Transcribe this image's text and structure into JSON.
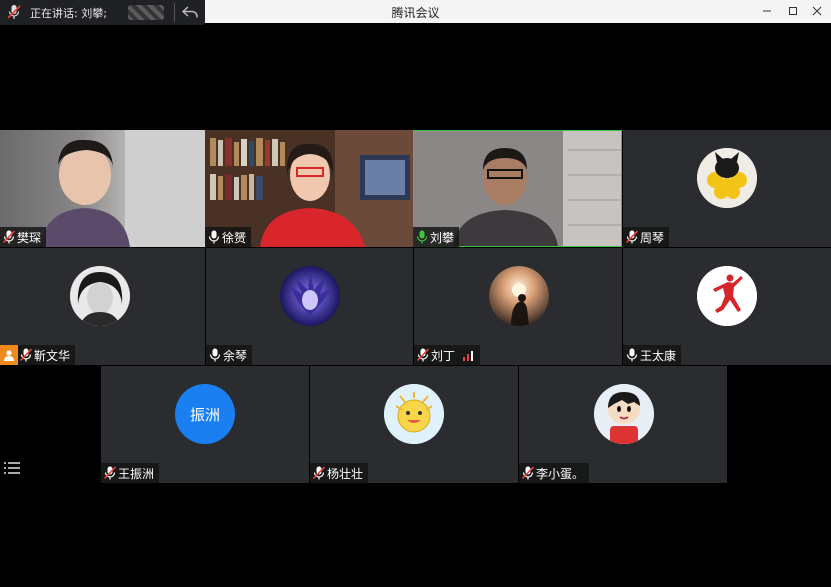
{
  "window": {
    "title": "腾讯会议",
    "speaking_label": "正在讲话: 刘攀;"
  },
  "participants": [
    {
      "name": "樊琛",
      "type": "video",
      "mic": "muted"
    },
    {
      "name": "徐赟",
      "type": "video",
      "mic": "on"
    },
    {
      "name": "刘攀",
      "type": "video",
      "mic": "speaking"
    },
    {
      "name": "周琴",
      "type": "avatar",
      "avatar": "cat-icon",
      "mic": "muted"
    },
    {
      "name": "靳文华",
      "type": "avatar",
      "avatar": "portrait-photo",
      "mic": "muted",
      "host": true
    },
    {
      "name": "余琴",
      "type": "avatar",
      "avatar": "anime-avatar",
      "mic": "on"
    },
    {
      "name": "刘丁",
      "type": "avatar",
      "avatar": "sunset-avatar",
      "mic": "muted",
      "signal": "signal-icon"
    },
    {
      "name": "王太康",
      "type": "avatar",
      "avatar": "jumpman-logo",
      "mic": "on"
    },
    {
      "name": "王振洲",
      "type": "avatar",
      "avatar_text": "振洲",
      "avatar_color": "#1a7ff0",
      "mic": "muted"
    },
    {
      "name": "杨壮壮",
      "type": "avatar",
      "avatar": "smiley-cartoon",
      "mic": "muted"
    },
    {
      "name": "李小蛋。",
      "type": "avatar",
      "avatar": "cartoon-kid",
      "mic": "muted"
    }
  ],
  "colors": {
    "muted": "#e8403a",
    "speaking": "#3ec53e",
    "host_badge": "#f08a1c",
    "tile": "#2b2c2f"
  }
}
